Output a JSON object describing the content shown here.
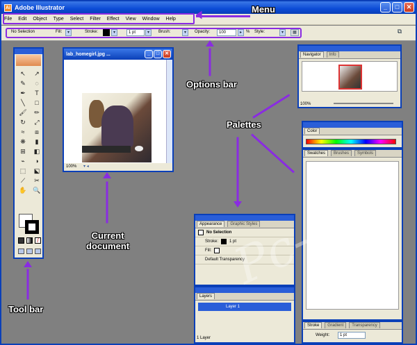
{
  "app": {
    "title": "Adobe Illustrator",
    "icon_letter": "Ai"
  },
  "window_buttons": {
    "minimize": "_",
    "maximize": "□",
    "close": "✕"
  },
  "menu": {
    "items": [
      "File",
      "Edit",
      "Object",
      "Type",
      "Select",
      "Filter",
      "Effect",
      "View",
      "Window",
      "Help"
    ]
  },
  "options_bar": {
    "selection": "No Selection",
    "fill_label": "Fill:",
    "stroke_label": "Stroke:",
    "stroke_weight": "1 pt",
    "brush_label": "Brush:",
    "opacity_label": "Opacity:",
    "opacity_value": "100",
    "percent": "%",
    "style_label": "Style:"
  },
  "document": {
    "title": "lab_homegirl.jpg ...",
    "zoom": "100%"
  },
  "navigator": {
    "tabs": [
      "Navigator",
      "Info"
    ],
    "zoom": "100%"
  },
  "color_palette": {
    "tab": "Color"
  },
  "swatches_palette": {
    "tabs": [
      "Swatches",
      "Brushes",
      "Symbols"
    ]
  },
  "stroke_palette": {
    "tabs": [
      "Stroke",
      "Gradient",
      "Transparency"
    ],
    "weight_label": "Weight:",
    "weight_value": "1 pt"
  },
  "appearance_palette": {
    "tabs": [
      "Appearance",
      "Graphic Styles"
    ],
    "selection": "No Selection",
    "stroke_label": "Stroke:",
    "stroke_value": "1 pt",
    "fill_label": "Fill:",
    "transparency": "Default Transparency"
  },
  "layers_palette": {
    "tab": "Layers",
    "layer_name": "Layer 1",
    "count": "1 Layer"
  },
  "annotations": {
    "menu": "Menu",
    "options_bar": "Options bar",
    "palettes": "Palettes",
    "current_document": "Current\ndocument",
    "tool_bar": "Tool bar"
  },
  "colors": {
    "accent": "#8a2be2",
    "titlebar": "#0a3fb8"
  },
  "watermark": "Pc-dis"
}
